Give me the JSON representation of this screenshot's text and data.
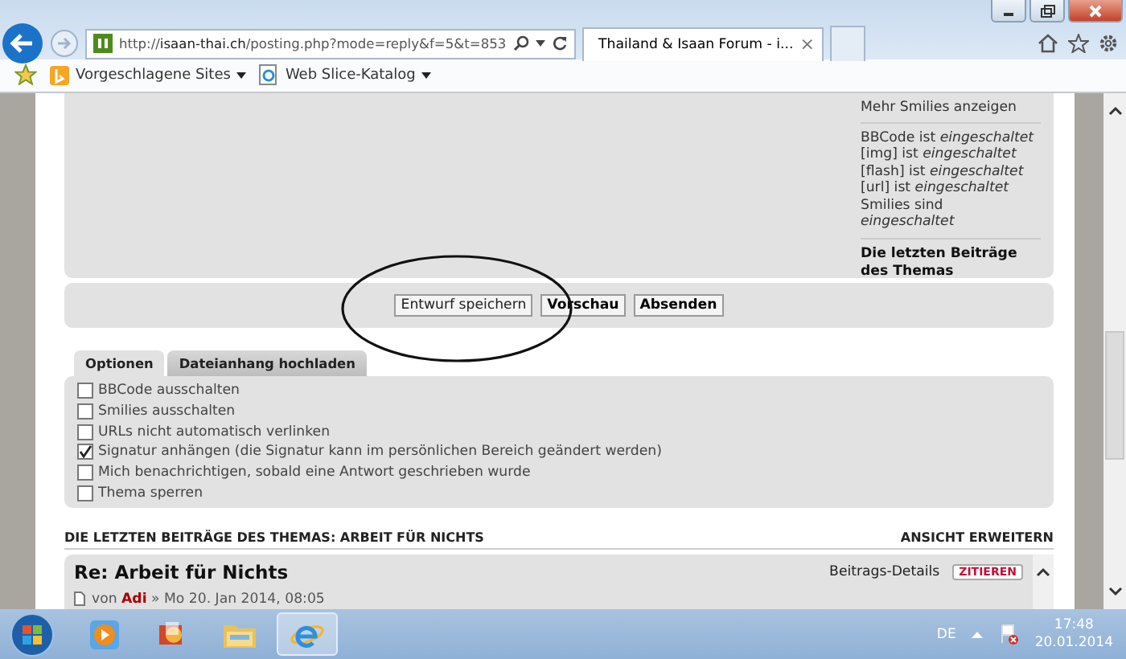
{
  "browser": {
    "address": "http://**isaan-thai.ch**/posting.php?mode=reply&f=5&t=853",
    "tabs": [
      {
        "title": "Thailand & Isaan Forum - i...",
        "close": "×",
        "selected": true
      }
    ],
    "favorites": [
      {
        "label": "Vorgeschlagene Sites",
        "kind": "bing"
      },
      {
        "label": "Web Slice-Katalog",
        "kind": "ie"
      }
    ]
  },
  "info_panel": {
    "link": "Mehr Smilies anzeigen",
    "status_lines": [
      "BBCode ist *eingeschaltet*",
      "[img] ist *eingeschaltet*",
      "[flash] ist *eingeschaltet*",
      "[url] ist *eingeschaltet*",
      "Smilies sind *eingeschaltet*"
    ],
    "heading": "Die letzten Beiträge des Themas"
  },
  "buttons": [
    {
      "label": "Entwurf speichern",
      "kind": "normal"
    },
    {
      "label": "Vorschau",
      "kind": "primary"
    },
    {
      "label": "Absenden",
      "kind": "primary"
    }
  ],
  "option_tabs": [
    {
      "label": "Optionen",
      "selected": true
    },
    {
      "label": "Dateianhang hochladen",
      "selected": false
    }
  ],
  "options": [
    {
      "label": "BBCode ausschalten",
      "checked": false
    },
    {
      "label": "Smilies ausschalten",
      "checked": false
    },
    {
      "label": "URLs nicht automatisch verlinken",
      "checked": false
    },
    {
      "label": "Signatur anhängen (die Signatur kann im persönlichen Bereich geändert werden)",
      "checked": true
    },
    {
      "label": "Mich benachrichtigen, sobald eine Antwort geschrieben wurde",
      "checked": false
    },
    {
      "label": "Thema sperren",
      "checked": false
    }
  ],
  "recent": {
    "title": "DIE LETZTEN BEITRÄGE DES THEMAS: ARBEIT FÜR NICHTS",
    "expand": "ANSICHT ERWEITERN",
    "posts": [
      {
        "title": "Re: Arbeit für Nichts",
        "details": "Beitrags-Details",
        "quote": "ZITIEREN",
        "by": "von",
        "author": "Adi",
        "date": "» Mo 20. Jan 2014, 08:05"
      }
    ]
  },
  "taskbar": {
    "apps": [
      {
        "kind": "media",
        "selected": false
      },
      {
        "kind": "office",
        "selected": false
      },
      {
        "kind": "folder",
        "selected": false
      },
      {
        "kind": "browser",
        "selected": true
      }
    ],
    "language": "DE",
    "time": "17:48",
    "date": "20.01.2014"
  }
}
